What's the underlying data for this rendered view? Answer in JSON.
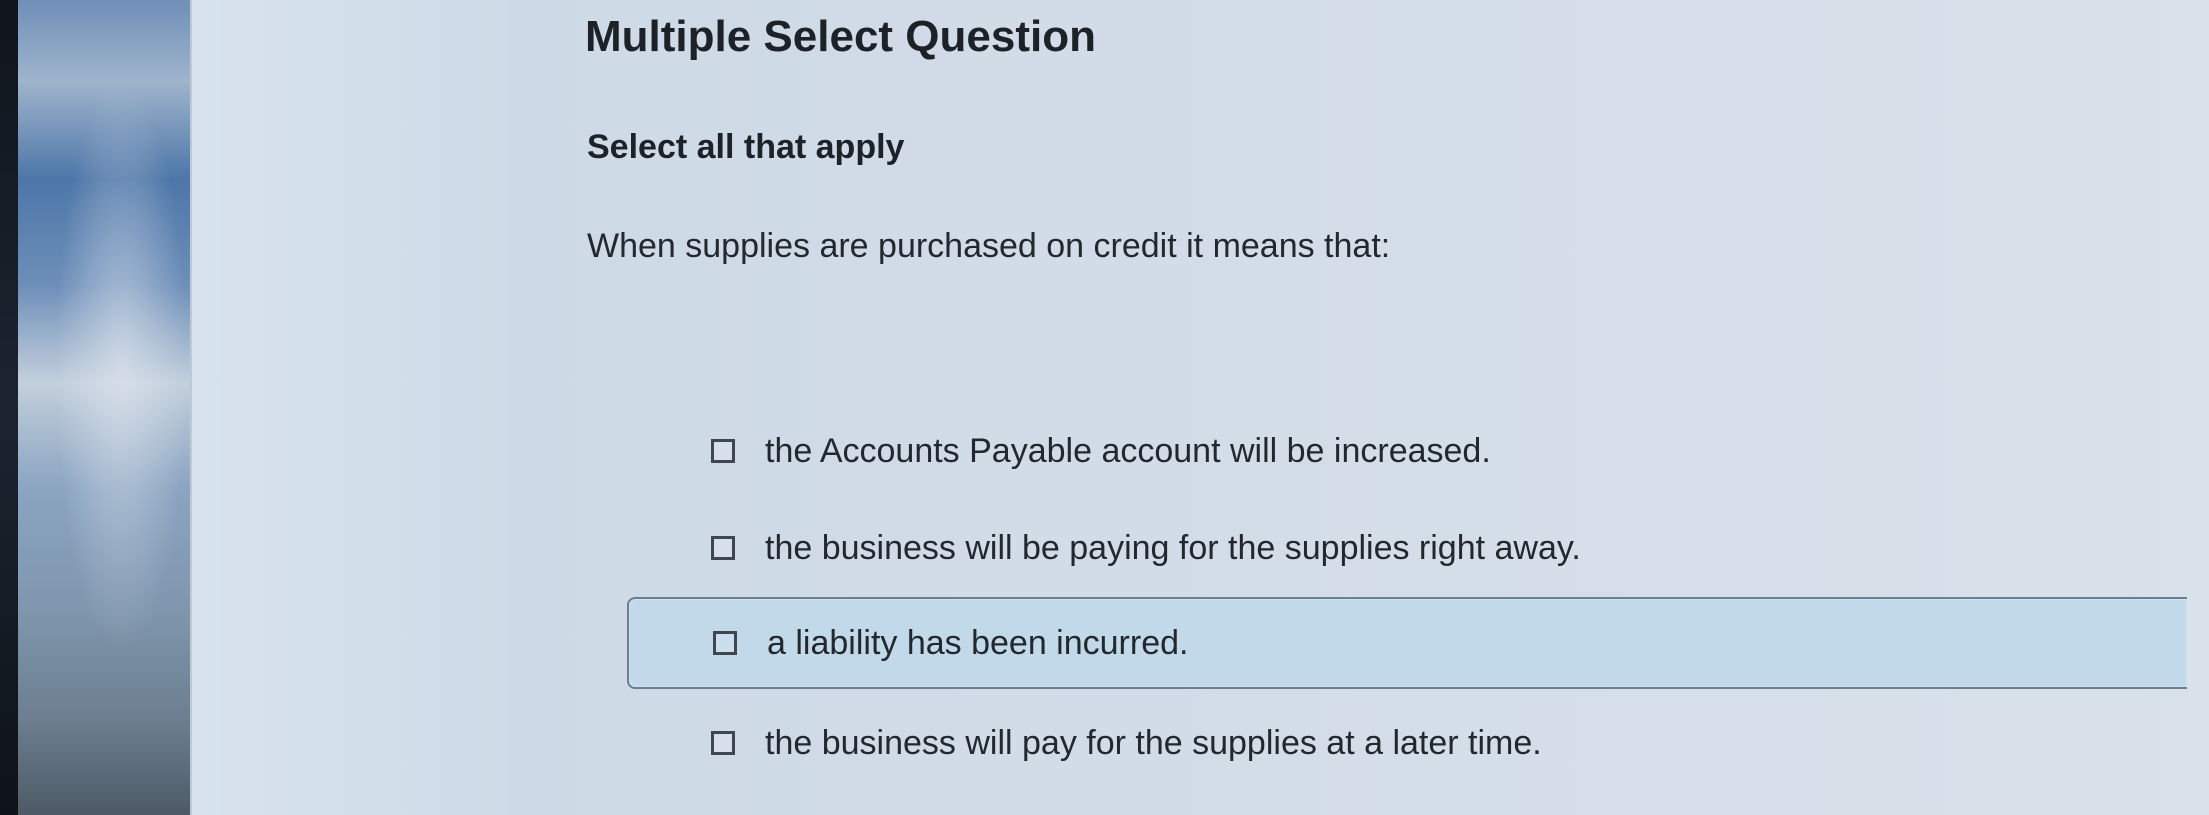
{
  "question": {
    "type_title": "Multiple Select Question",
    "instruction": "Select all that apply",
    "prompt": "When supplies are purchased on credit it means that:"
  },
  "options": [
    {
      "label": "the Accounts Payable account will be increased.",
      "checked": false,
      "highlighted": false
    },
    {
      "label": "the business will be paying for the supplies right away.",
      "checked": false,
      "highlighted": false
    },
    {
      "label": "a liability has been incurred.",
      "checked": false,
      "highlighted": true
    },
    {
      "label": "the business will pay for the supplies at a later time.",
      "checked": false,
      "highlighted": false
    }
  ],
  "colors": {
    "text": "#23282e",
    "highlight_background": "#c2d9ea",
    "highlight_border": "#6b7f93",
    "checkbox_border": "#3e4750"
  }
}
